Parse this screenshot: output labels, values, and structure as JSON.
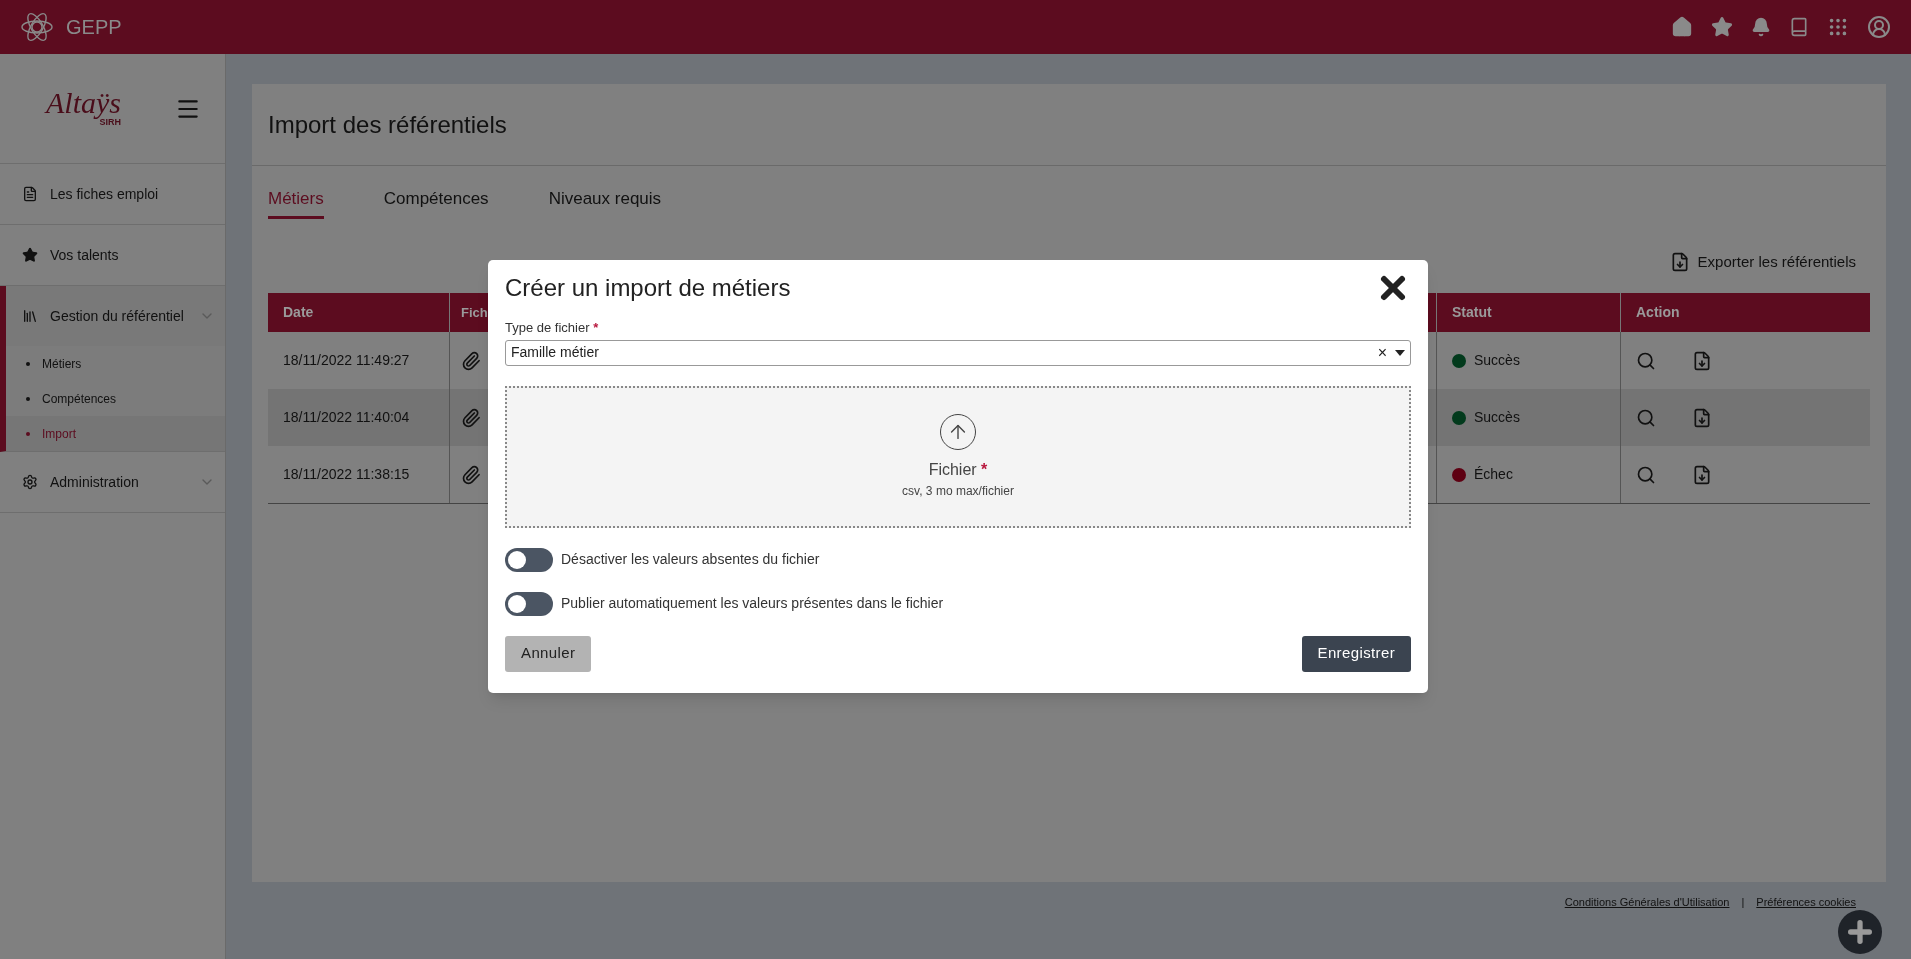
{
  "app": {
    "name": "GEPP"
  },
  "sidebar": {
    "logo": {
      "text": "Altaÿs",
      "sub": "SIRH"
    },
    "items": [
      {
        "label": "Les fiches emploi",
        "kind": "document",
        "selected": false,
        "expandable": false
      },
      {
        "label": "Vos talents",
        "kind": "star",
        "selected": false,
        "expandable": false
      },
      {
        "label": "Gestion du référentiel",
        "kind": "library",
        "selected": true,
        "expandable": true,
        "children": [
          {
            "label": "Métiers",
            "selected": false
          },
          {
            "label": "Compétences",
            "selected": false
          },
          {
            "label": "Import",
            "selected": true
          }
        ]
      },
      {
        "label": "Administration",
        "kind": "gear",
        "selected": false,
        "expandable": true
      }
    ]
  },
  "page": {
    "title": "Import des référentiels",
    "tabs": [
      {
        "label": "Métiers",
        "selected": true
      },
      {
        "label": "Compétences",
        "selected": false
      },
      {
        "label": "Niveaux requis",
        "selected": false
      }
    ],
    "export_button": "Exporter les référentiels",
    "table": {
      "columns": [
        "Date",
        "Fich",
        "Statut",
        "Action"
      ],
      "rows": [
        {
          "date": "18/11/2022 11:49:27",
          "status": "Succès",
          "color": "#023a1c",
          "highlighted": false
        },
        {
          "date": "18/11/2022 11:40:04",
          "status": "Succès",
          "color": "#023a1c",
          "highlighted": true
        },
        {
          "date": "18/11/2022 11:38:15",
          "status": "Échec",
          "color": "#5e0012",
          "highlighted": false
        }
      ]
    }
  },
  "footer": {
    "links": [
      "Conditions Générales d'Utilisation",
      "Préférences cookies"
    ],
    "separator": "|"
  },
  "modal": {
    "title": "Créer un import de métiers",
    "field": {
      "label": "Type de fichier",
      "required_mark": "*",
      "value": "Famille métier",
      "clear": "×"
    },
    "dropzone": {
      "label": "Fichier",
      "required_mark": "*",
      "hint": "csv, 3 mo max/fichier"
    },
    "toggles": [
      {
        "label": "Désactiver les valeurs absentes du fichier",
        "on": false
      },
      {
        "label": "Publier automatiquement les valeurs présentes dans le fichier",
        "on": false
      }
    ],
    "cancel": "Annuler",
    "save": "Enregistrer"
  }
}
